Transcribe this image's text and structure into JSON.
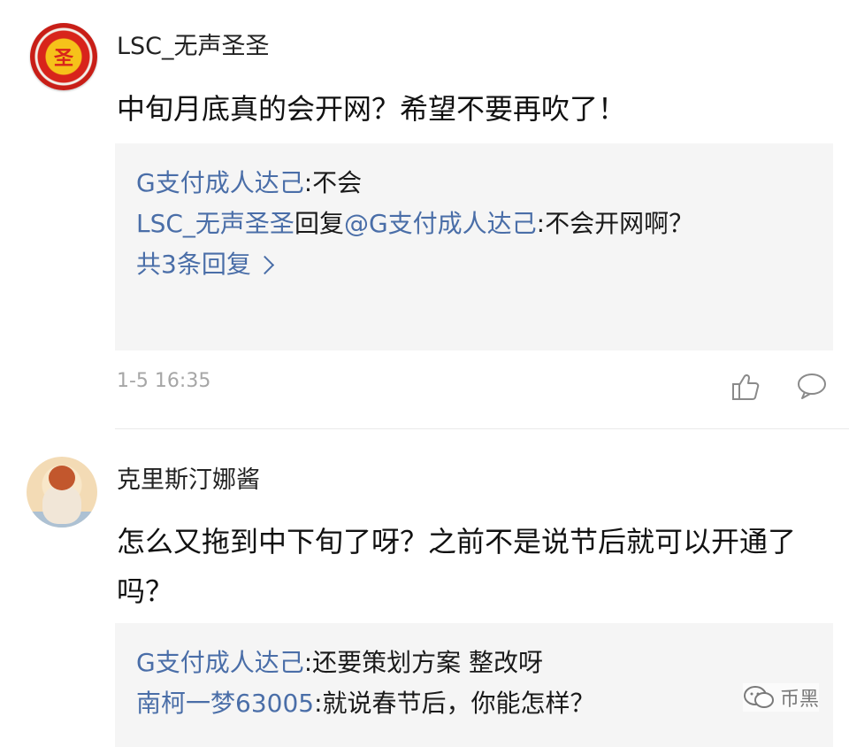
{
  "comments": [
    {
      "username": "LSC_无声圣圣",
      "avatar_glyph": "圣",
      "content": "中旬月底真的会开网？希望不要再吹了！",
      "replies": [
        {
          "name": "G支付成人达己",
          "text": ":不会"
        },
        {
          "name": "LSC_无声圣圣",
          "connector": "回复",
          "target": "@G支付成人达己",
          "text": ":不会开网啊？"
        }
      ],
      "more_replies_label": "共3条回复",
      "timestamp": "1-5 16:35"
    },
    {
      "username": "克里斯汀娜酱",
      "content": "怎么又拖到中下旬了呀？之前不是说节后就可以开通了吗？",
      "replies": [
        {
          "name": "G支付成人达己",
          "text": ":还要策划方案 整改呀"
        },
        {
          "name": "南柯一梦63005",
          "text": ":就说春节后，你能怎样？"
        }
      ]
    }
  ],
  "watermark": {
    "label": "币黑",
    "icon": "wechat-icon"
  },
  "colors": {
    "link": "#4a6ea8",
    "reply_bg": "#f5f5f5",
    "timestamp": "#a6a6a6"
  }
}
